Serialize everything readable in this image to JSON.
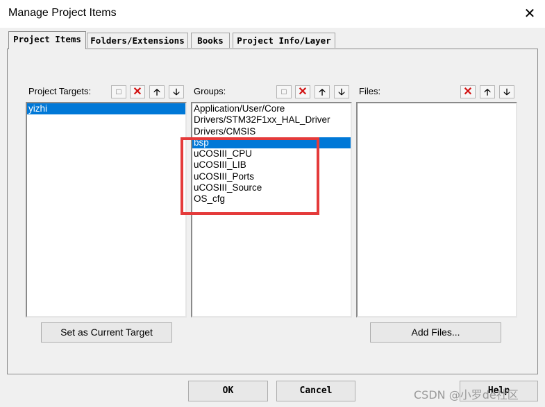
{
  "window": {
    "title": "Manage Project Items",
    "close_glyph": "✕"
  },
  "tabs": [
    {
      "label": "Project Items",
      "active": true
    },
    {
      "label": "Folders/Extensions",
      "active": false
    },
    {
      "label": "Books",
      "active": false
    },
    {
      "label": "Project Info/Layer",
      "active": false
    }
  ],
  "targets": {
    "label": "Project Targets:",
    "items": [
      "yizhi"
    ],
    "selected": 0,
    "toolbar_icons": [
      "new-icon",
      "delete-icon",
      "move-up-icon",
      "move-down-icon"
    ],
    "button": "Set as Current Target"
  },
  "groups": {
    "label": "Groups:",
    "items": [
      "Application/User/Core",
      "Drivers/STM32F1xx_HAL_Driver",
      "Drivers/CMSIS",
      "bsp",
      "uCOSIII_CPU",
      "uCOSIII_LIB",
      "uCOSIII_Ports",
      "uCOSIII_Source",
      "OS_cfg"
    ],
    "selected": 3,
    "toolbar_icons": [
      "new-icon",
      "delete-icon",
      "move-up-icon",
      "move-down-icon"
    ]
  },
  "files": {
    "label": "Files:",
    "items": [],
    "toolbar_icons": [
      "delete-icon",
      "move-up-icon",
      "move-down-icon"
    ],
    "button": "Add Files..."
  },
  "footer": {
    "ok": "OK",
    "cancel": "Cancel",
    "help": "Help"
  },
  "annotation_color": "#e43a3a",
  "selection_color": "#0078d7",
  "watermark": "CSDN @小罗de社区"
}
